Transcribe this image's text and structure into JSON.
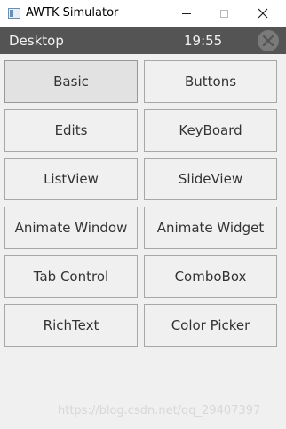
{
  "window": {
    "title": "AWTK Simulator",
    "controls": {
      "minimize": "minimize",
      "maximize": "maximize",
      "close": "close"
    }
  },
  "statusbar": {
    "title": "Desktop",
    "time": "19:55"
  },
  "menu": {
    "basic": "Basic",
    "buttons": "Buttons",
    "edits": "Edits",
    "keyboard": "KeyBoard",
    "listview": "ListView",
    "slideview": "SlideView",
    "animate_window": "Animate Window",
    "animate_widget": "Animate Widget",
    "tab_control": "Tab Control",
    "combobox": "ComboBox",
    "richtext": "RichText",
    "color_picker": "Color Picker"
  },
  "watermark": "https://blog.csdn.net/qq_29407397",
  "colors": {
    "statusbar": "#545454",
    "background": "#f0f0f0",
    "active_button": "#e2e2e2"
  }
}
